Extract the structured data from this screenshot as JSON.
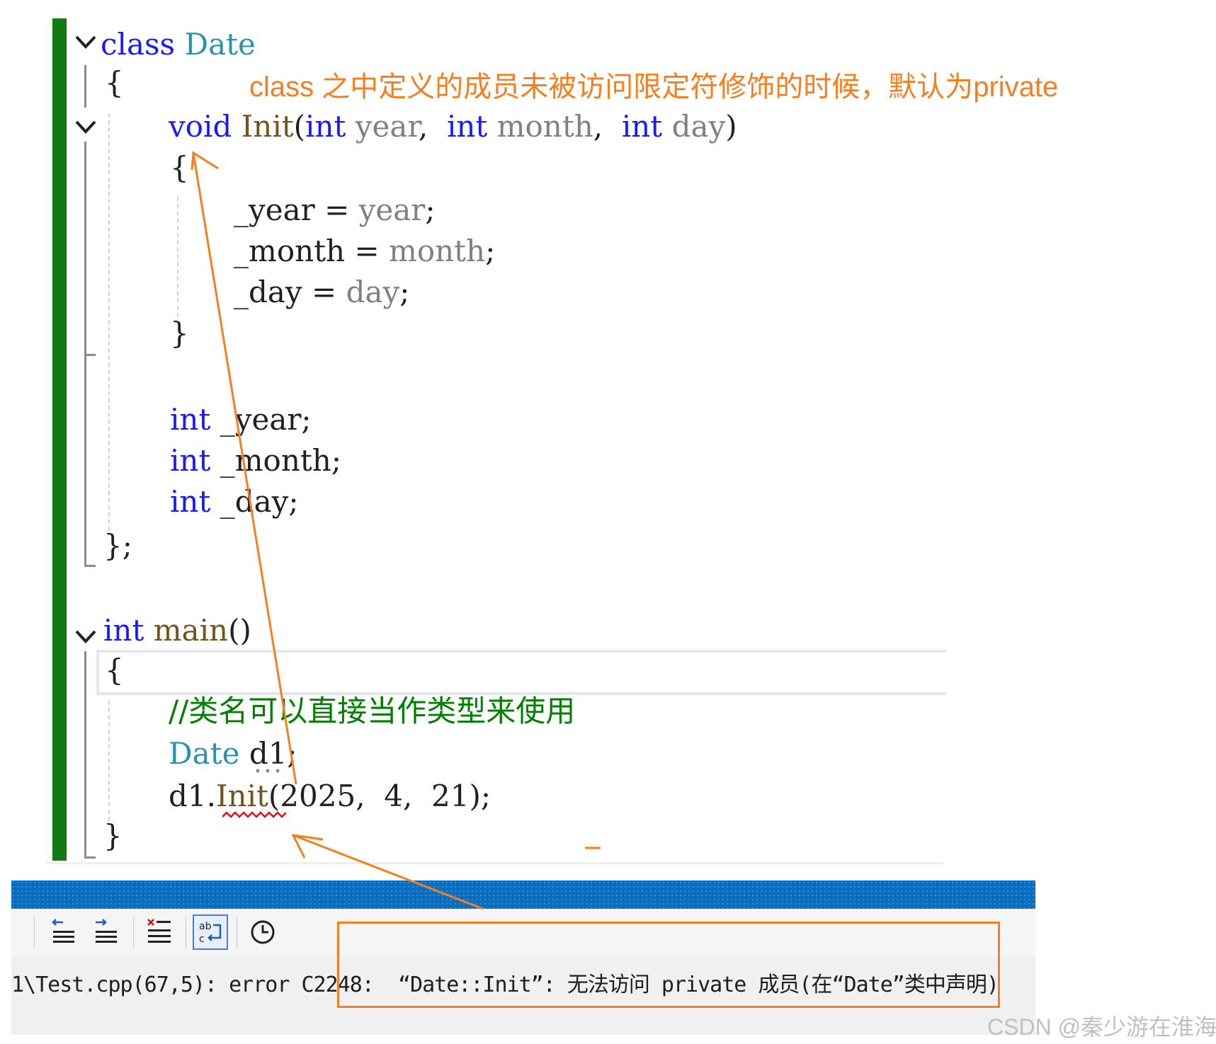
{
  "annotation": "class 之中定义的成员未被访问限定符修饰的时候，默认为private",
  "code": {
    "class_kw": "class",
    "class_name": "Date",
    "open_brace": "{",
    "void_kw": "void",
    "init_fn": "Init",
    "lparen": "(",
    "int_kw": "int",
    "p_year": "year",
    "comma": ",",
    "p_month": "month",
    "p_day": "day",
    "rparen": ")",
    "stmt_year_lhs": "_year",
    "eq": "=",
    "stmt_year_rhs": "year",
    "semi": ";",
    "stmt_month_lhs": "_month",
    "stmt_month_rhs": "month",
    "stmt_day_lhs": "_day",
    "stmt_day_rhs": "day",
    "close_brace": "}",
    "member_year": "_year;",
    "member_month": "_month;",
    "member_day": "_day;",
    "class_end": "};",
    "main_fn": "main",
    "main_parens": "()",
    "comment": "//类名可以直接当作类型来使用",
    "decl_type": "Date",
    "decl_var": "d1",
    "call_obj": "d1.",
    "call_fn": "Init",
    "call_args": "(2025,  4,  21);"
  },
  "output": {
    "prefix": "1\\Test.cpp(67,5): error C2248: ",
    "message": " “Date::Init”: 无法访问 private 成员(在“Date”类中声明)"
  },
  "toolbar": {
    "buttons": [
      "outdent-icon",
      "indent-icon",
      "clear-errors-icon",
      "word-wrap-icon",
      "history-icon"
    ]
  },
  "watermark": "CSDN @秦少游在淮海",
  "colors": {
    "keyword": "#1a1aff",
    "type": "#2b91af",
    "function": "#74531f",
    "parameter": "#808080",
    "comment": "#008000",
    "annotation": "#f57e1f",
    "gutter": "#117a11",
    "titlebar": "#0a6ec0"
  }
}
